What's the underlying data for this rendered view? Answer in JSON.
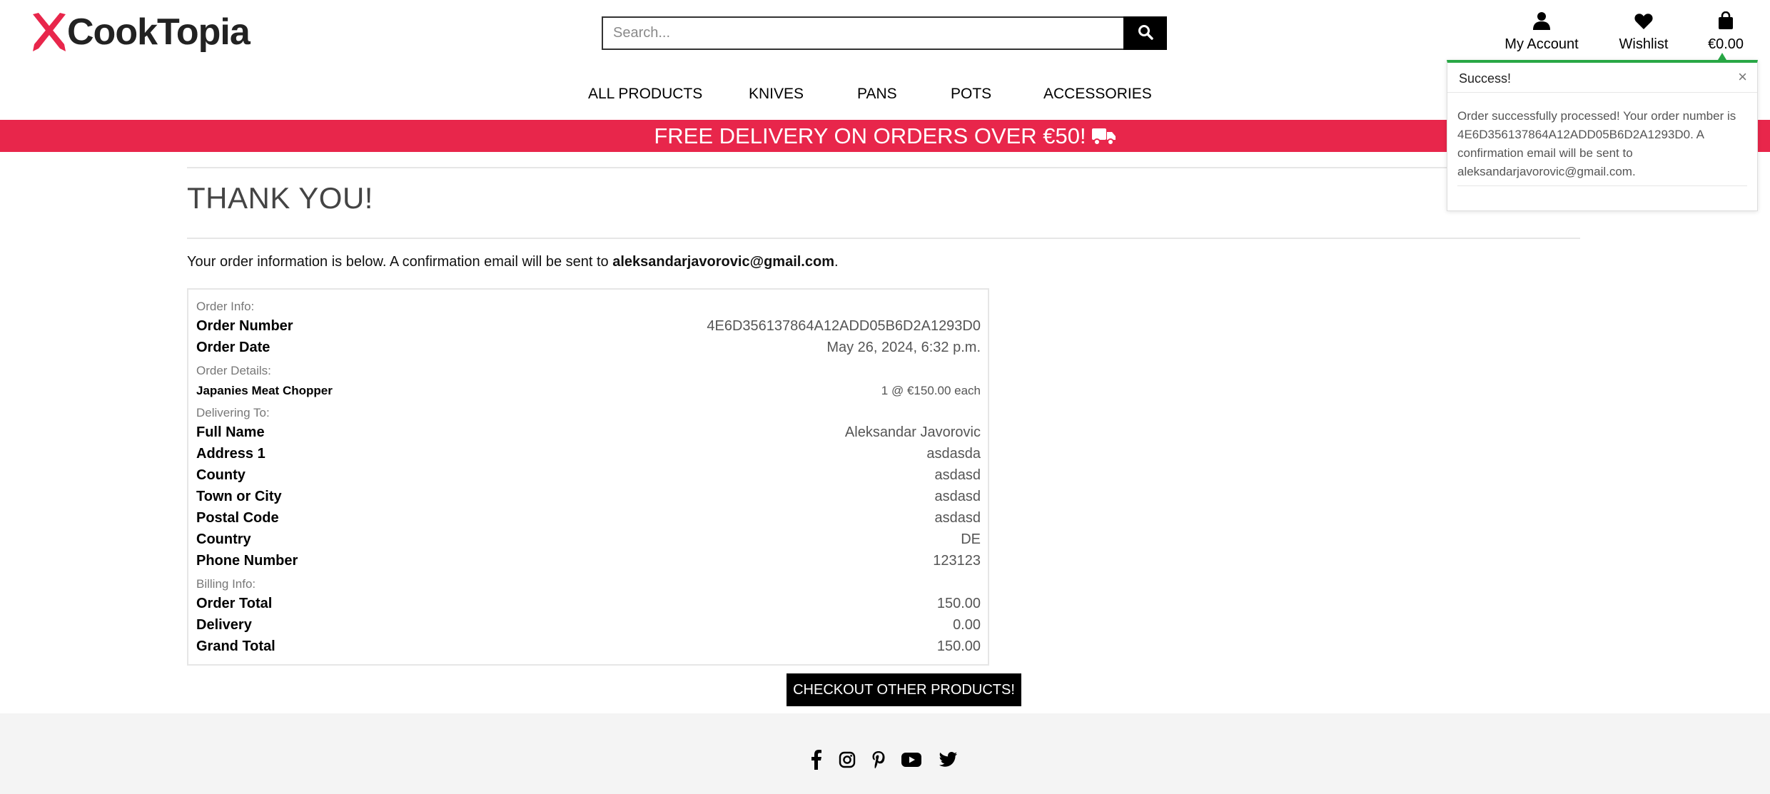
{
  "brand": {
    "name": "CookTopia",
    "accent": "#e8264b"
  },
  "search": {
    "placeholder": "Search..."
  },
  "account_nav": [
    {
      "label": "My Account",
      "icon": "user-icon"
    },
    {
      "label": "Wishlist",
      "icon": "heart-icon"
    },
    {
      "label": "€0.00",
      "icon": "shopping-bag-icon"
    }
  ],
  "main_nav": [
    "ALL PRODUCTS",
    "KNIVES",
    "PANS",
    "POTS",
    "ACCESSORIES"
  ],
  "promo": {
    "text": "FREE DELIVERY ON ORDERS OVER €50!",
    "icon": "truck-icon",
    "color": "#e8264b"
  },
  "page": {
    "title": "THANK YOU!",
    "intro_prefix": "Your order information is below. A confirmation email will be sent to ",
    "email": "aleksandarjavorovic@gmail.com",
    "intro_suffix": "."
  },
  "order": {
    "order_info_label": "Order Info:",
    "order_number_label": "Order Number",
    "order_number": "4E6D356137864A12ADD05B6D2A1293D0",
    "order_date_label": "Order Date",
    "order_date": "May 26, 2024, 6:32 p.m.",
    "order_details_label": "Order Details:",
    "item_name": "Japanies Meat Chopper",
    "item_qty_price": "1 @ €150.00 each",
    "delivering_label": "Delivering To:",
    "delivery": [
      {
        "label": "Full Name",
        "value": "Aleksandar Javorovic"
      },
      {
        "label": "Address 1",
        "value": "asdasda"
      },
      {
        "label": "County",
        "value": "asdasd"
      },
      {
        "label": "Town or City",
        "value": "asdasd"
      },
      {
        "label": "Postal Code",
        "value": "asdasd"
      },
      {
        "label": "Country",
        "value": "DE"
      },
      {
        "label": "Phone Number",
        "value": "123123"
      }
    ],
    "billing_label": "Billing Info:",
    "billing": [
      {
        "label": "Order Total",
        "value": "150.00"
      },
      {
        "label": "Delivery",
        "value": "0.00"
      },
      {
        "label": "Grand Total",
        "value": "150.00"
      }
    ]
  },
  "checkout_button": "CHECKOUT OTHER PRODUCTS!",
  "footer": {
    "social_icons": [
      "facebook-icon",
      "instagram-icon",
      "pinterest-icon",
      "youtube-icon",
      "twitter-icon"
    ]
  },
  "toast": {
    "title": "Success!",
    "close": "×",
    "message": "Order successfully processed! Your order number is 4E6D356137864A12ADD05B6D2A1293D0. A confirmation email will be sent to aleksandarjavorovic@gmail.com.",
    "accent": "#28a745"
  }
}
